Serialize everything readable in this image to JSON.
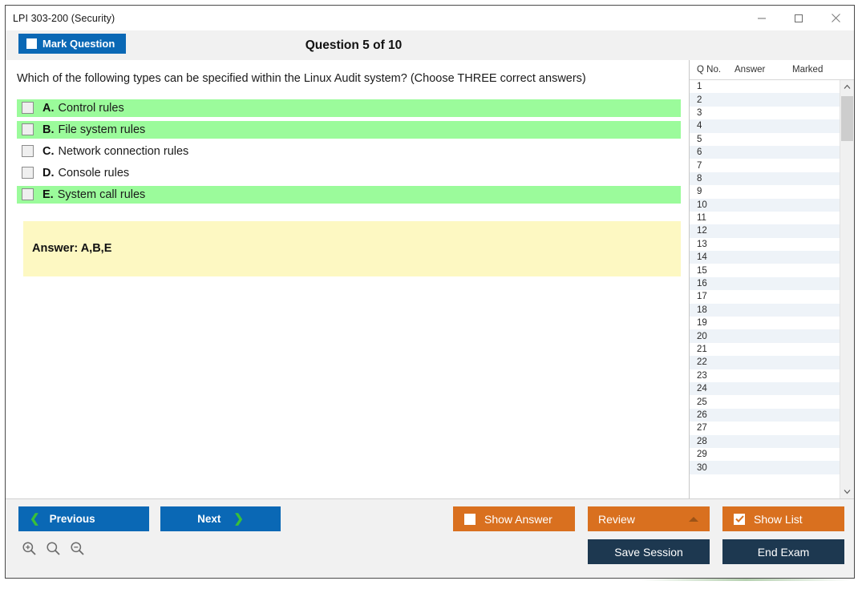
{
  "window": {
    "title": "LPI 303-200 (Security)",
    "controls": {
      "minimize": "minimize-icon",
      "maximize": "maximize-icon",
      "close": "close-icon"
    }
  },
  "header": {
    "mark_question_label": "Mark Question",
    "mark_question_checked": false,
    "question_counter": "Question 5 of 10"
  },
  "question": {
    "text": "Which of the following types can be specified within the Linux Audit system? (Choose THREE correct answers)",
    "options": [
      {
        "letter": "A.",
        "text": "Control rules",
        "correct": true,
        "checked": false
      },
      {
        "letter": "B.",
        "text": "File system rules",
        "correct": true,
        "checked": false
      },
      {
        "letter": "C.",
        "text": "Network connection rules",
        "correct": false,
        "checked": false
      },
      {
        "letter": "D.",
        "text": "Console rules",
        "correct": false,
        "checked": false
      },
      {
        "letter": "E.",
        "text": "System call rules",
        "correct": true,
        "checked": false
      }
    ],
    "answer_label": "Answer: A,B,E"
  },
  "list_panel": {
    "columns": [
      "Q No.",
      "Answer",
      "Marked"
    ],
    "rows": [
      {
        "no": "1",
        "answer": "",
        "marked": ""
      },
      {
        "no": "2",
        "answer": "",
        "marked": ""
      },
      {
        "no": "3",
        "answer": "",
        "marked": ""
      },
      {
        "no": "4",
        "answer": "",
        "marked": ""
      },
      {
        "no": "5",
        "answer": "",
        "marked": ""
      },
      {
        "no": "6",
        "answer": "",
        "marked": ""
      },
      {
        "no": "7",
        "answer": "",
        "marked": ""
      },
      {
        "no": "8",
        "answer": "",
        "marked": ""
      },
      {
        "no": "9",
        "answer": "",
        "marked": ""
      },
      {
        "no": "10",
        "answer": "",
        "marked": ""
      },
      {
        "no": "11",
        "answer": "",
        "marked": ""
      },
      {
        "no": "12",
        "answer": "",
        "marked": ""
      },
      {
        "no": "13",
        "answer": "",
        "marked": ""
      },
      {
        "no": "14",
        "answer": "",
        "marked": ""
      },
      {
        "no": "15",
        "answer": "",
        "marked": ""
      },
      {
        "no": "16",
        "answer": "",
        "marked": ""
      },
      {
        "no": "17",
        "answer": "",
        "marked": ""
      },
      {
        "no": "18",
        "answer": "",
        "marked": ""
      },
      {
        "no": "19",
        "answer": "",
        "marked": ""
      },
      {
        "no": "20",
        "answer": "",
        "marked": ""
      },
      {
        "no": "21",
        "answer": "",
        "marked": ""
      },
      {
        "no": "22",
        "answer": "",
        "marked": ""
      },
      {
        "no": "23",
        "answer": "",
        "marked": ""
      },
      {
        "no": "24",
        "answer": "",
        "marked": ""
      },
      {
        "no": "25",
        "answer": "",
        "marked": ""
      },
      {
        "no": "26",
        "answer": "",
        "marked": ""
      },
      {
        "no": "27",
        "answer": "",
        "marked": ""
      },
      {
        "no": "28",
        "answer": "",
        "marked": ""
      },
      {
        "no": "29",
        "answer": "",
        "marked": ""
      },
      {
        "no": "30",
        "answer": "",
        "marked": ""
      }
    ]
  },
  "footer": {
    "previous_label": "Previous",
    "next_label": "Next",
    "show_answer_label": "Show Answer",
    "show_answer_checked": false,
    "review_label": "Review",
    "show_list_label": "Show List",
    "show_list_checked": true,
    "save_session_label": "Save Session",
    "end_exam_label": "End Exam",
    "zoom_icons": [
      "zoom-in-icon",
      "zoom-reset-icon",
      "zoom-out-icon"
    ]
  },
  "colors": {
    "primary_blue": "#0a68b5",
    "orange": "#d9701f",
    "navy": "#1d3850",
    "correct_green": "#9bfb9b",
    "answer_yellow": "#fdf8c2",
    "chevron_green": "#39c039"
  }
}
